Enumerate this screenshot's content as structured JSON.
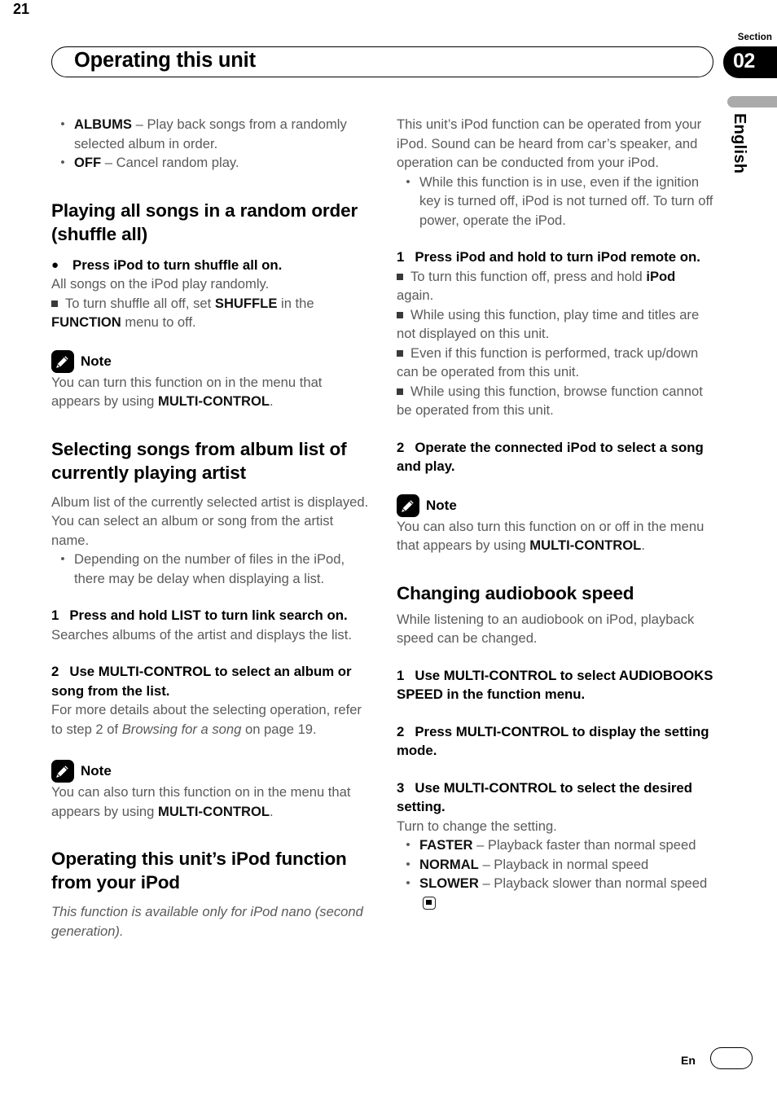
{
  "header": {
    "title": "Operating this unit",
    "section_label": "Section",
    "section_number": "02",
    "language_tab": "English"
  },
  "footer": {
    "language_code": "En",
    "page_number": "21"
  },
  "icons": {
    "note": "pencil-note-icon",
    "end_of_section": "end-of-section-marker"
  },
  "left_column": {
    "random_options": [
      {
        "term": "ALBUMS",
        "dash": " – ",
        "desc": "Play back songs from a randomly selected album in order."
      },
      {
        "term": "OFF",
        "dash": " – ",
        "desc": "Cancel random play."
      }
    ],
    "shuffle_all": {
      "heading": "Playing all songs in a random order (shuffle all)",
      "bullet_glyph": "●",
      "action": "Press iPod to turn shuffle all on.",
      "body": "All songs on the iPod play randomly.",
      "note_pre": "To turn shuffle all off, set ",
      "note_bold1": "SHUFFLE",
      "note_mid": " in the ",
      "note_bold2": "FUNCTION",
      "note_post": " menu to off.",
      "note": {
        "title": "Note",
        "pre": "You can turn this function on in the menu that appears by using ",
        "bold": "MULTI-CONTROL",
        "post": "."
      }
    },
    "album_list": {
      "heading": "Selecting songs from album list of currently playing artist",
      "body": "Album list of the currently selected artist is displayed. You can select an album or song from the artist name.",
      "bullet": "Depending on the number of files in the iPod, there may be delay when displaying a list.",
      "step1": {
        "num": "1",
        "title": "Press and hold LIST to turn link search on.",
        "body": "Searches albums of the artist and displays the list."
      },
      "step2": {
        "num": "2",
        "title": "Use MULTI-CONTROL to select an album or song from the list.",
        "body_pre": "For more details about the selecting operation, refer to step 2 of ",
        "body_italic": "Browsing for a song",
        "body_post": " on page 19."
      },
      "note": {
        "title": "Note",
        "pre": "You can also turn this function on in the menu that appears by using ",
        "bold": "MULTI-CONTROL",
        "post": "."
      }
    },
    "ipod_function": {
      "heading": "Operating this unit’s iPod function from your iPod",
      "italic_body": "This function is available only for iPod nano (second generation)."
    }
  },
  "right_column": {
    "intro": "This unit’s iPod function can be operated from your iPod. Sound can be heard from car’s speaker, and operation can be conducted from your iPod.",
    "intro_bullet": "While this function is in use, even if the ignition key is turned off, iPod is not turned off. To turn off power, operate the iPod.",
    "step1": {
      "num": "1",
      "title": "Press iPod and hold to turn iPod remote on.",
      "notes": [
        {
          "pre": "To turn this function off, press and hold ",
          "bold": "iPod",
          "post": " again."
        },
        {
          "pre": "While using this function, play time and titles are not displayed on this unit.",
          "bold": "",
          "post": ""
        },
        {
          "pre": "Even if this function is performed, track up/down can be operated from this unit.",
          "bold": "",
          "post": ""
        },
        {
          "pre": "While using this function, browse function cannot be operated from this unit.",
          "bold": "",
          "post": ""
        }
      ]
    },
    "step2": {
      "num": "2",
      "title": "Operate the connected iPod to select a song and play."
    },
    "note": {
      "title": "Note",
      "pre": "You can also turn this function on or off in the menu that appears by using ",
      "bold": "MULTI-CONTROL",
      "post": "."
    },
    "audiobook": {
      "heading": "Changing audiobook speed",
      "body": "While listening to an audiobook on iPod, playback speed can be changed.",
      "step1": {
        "num": "1",
        "title": "Use MULTI-CONTROL to select AUDIOBOOKS SPEED in the function menu."
      },
      "step2": {
        "num": "2",
        "title": "Press MULTI-CONTROL to display the setting mode."
      },
      "step3": {
        "num": "3",
        "title": "Use MULTI-CONTROL to select the desired setting.",
        "body": "Turn to change the setting."
      },
      "options": [
        {
          "term": "FASTER",
          "dash": " – ",
          "desc": "Playback faster than normal speed"
        },
        {
          "term": "NORMAL",
          "dash": " – ",
          "desc": "Playback in normal speed"
        },
        {
          "term": "SLOWER",
          "dash": " – ",
          "desc": "Playback slower than normal speed"
        }
      ]
    }
  }
}
